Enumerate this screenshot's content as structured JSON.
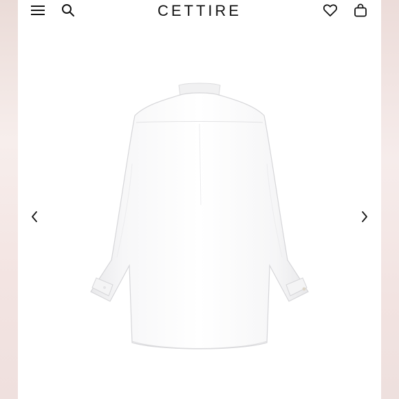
{
  "header": {
    "brand": "CETTIRE",
    "icons": {
      "menu": "hamburger-menu-icon",
      "search": "search-icon",
      "wishlist": "heart-icon",
      "bag": "shopping-bag-icon"
    }
  },
  "gallery": {
    "image": "white-shirt-back-view",
    "prev_icon": "chevron-left-icon",
    "next_icon": "chevron-right-icon"
  },
  "colors": {
    "background": "#ffffff",
    "frame": "#f2e6e3",
    "text": "#111111"
  }
}
